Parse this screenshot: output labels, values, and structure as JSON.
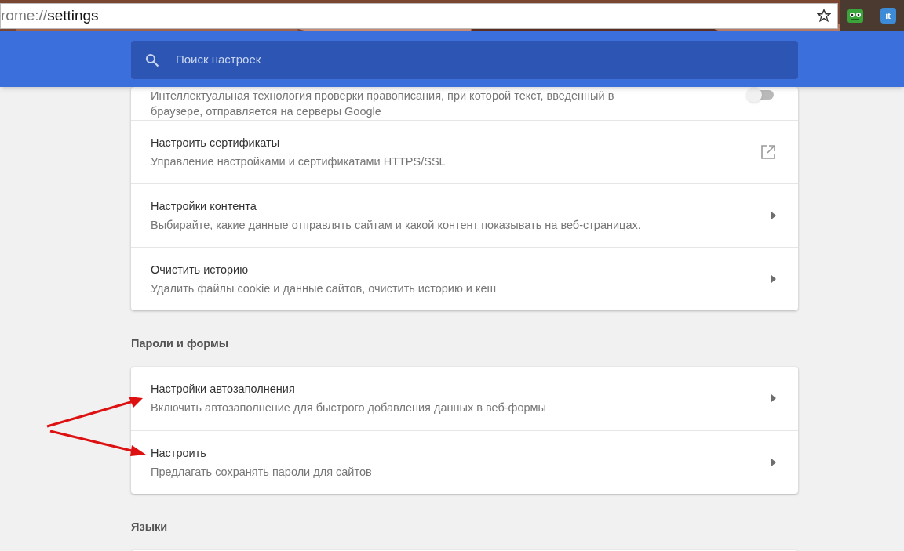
{
  "address_bar": {
    "scheme": "rome://",
    "path": "settings",
    "bookmarked": false
  },
  "extensions": [
    {
      "kind": "robot"
    },
    {
      "kind": "label",
      "text": "it"
    }
  ],
  "search": {
    "placeholder": "Поиск настроек"
  },
  "sections": [
    {
      "rows": [
        {
          "kind": "toggle",
          "subtitle": "Интеллектуальная технология проверки правописания, при которой текст, введенный в браузере, отправляется на серверы Google",
          "on": false
        },
        {
          "kind": "external",
          "title": "Настроить сертификаты",
          "subtitle": "Управление настройками и сертификатами HTTPS/SSL"
        },
        {
          "kind": "arrow",
          "title": "Настройки контента",
          "subtitle": "Выбирайте, какие данные отправлять сайтам и какой контент показывать на веб-страницах."
        },
        {
          "kind": "arrow",
          "title": "Очистить историю",
          "subtitle": "Удалить файлы cookie и данные сайтов, очистить историю и кеш"
        }
      ]
    },
    {
      "heading": "Пароли и формы",
      "rows": [
        {
          "kind": "arrow",
          "title": "Настройки автозаполнения",
          "subtitle": "Включить автозаполнение для быстрого добавления данных в веб-формы",
          "annotated": true
        },
        {
          "kind": "arrow",
          "title": "Настроить",
          "subtitle": "Предлагать сохранять пароли для сайтов",
          "annotated": true
        }
      ]
    },
    {
      "heading": "Языки"
    }
  ]
}
